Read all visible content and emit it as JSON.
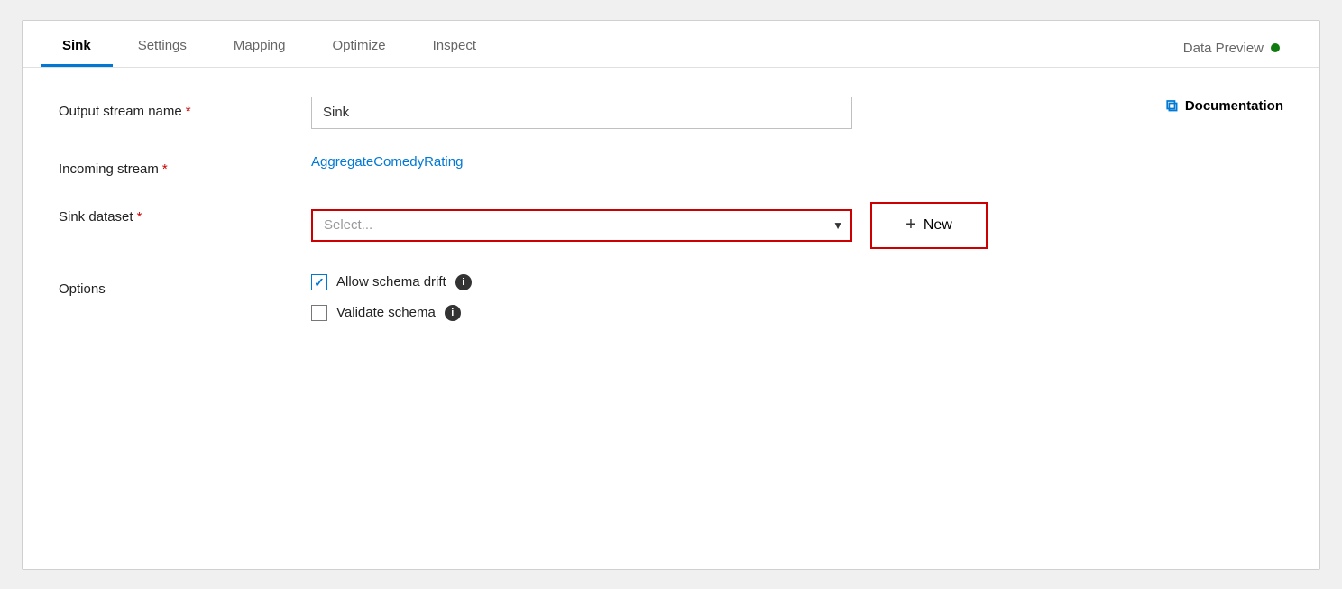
{
  "tabs": [
    {
      "id": "sink",
      "label": "Sink",
      "active": true
    },
    {
      "id": "settings",
      "label": "Settings",
      "active": false
    },
    {
      "id": "mapping",
      "label": "Mapping",
      "active": false
    },
    {
      "id": "optimize",
      "label": "Optimize",
      "active": false
    },
    {
      "id": "inspect",
      "label": "Inspect",
      "active": false
    },
    {
      "id": "data-preview",
      "label": "Data Preview",
      "active": false
    }
  ],
  "form": {
    "output_stream_name_label": "Output stream name",
    "output_stream_name_value": "Sink",
    "output_stream_name_placeholder": "Sink",
    "required_star": "*",
    "incoming_stream_label": "Incoming stream",
    "incoming_stream_value": "AggregateComedyRating",
    "sink_dataset_label": "Sink dataset",
    "sink_dataset_placeholder": "Select...",
    "options_label": "Options",
    "allow_schema_drift_label": "Allow schema drift",
    "validate_schema_label": "Validate schema",
    "new_button_label": "New",
    "new_button_plus": "+",
    "documentation_label": "Documentation",
    "doc_icon": "⧉"
  },
  "colors": {
    "active_tab_underline": "#0078d4",
    "link": "#0078d4",
    "required": "#cc0000",
    "error_border": "#cc0000",
    "checkbox_check": "#0078d4",
    "dot_green": "#107c10",
    "new_button_border": "#cc0000"
  }
}
